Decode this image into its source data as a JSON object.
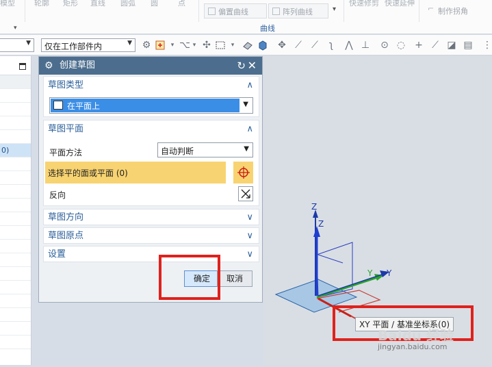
{
  "ribbon": {
    "top_items": [
      "轮廓",
      "矩形",
      "直线",
      "圆弧",
      "圆",
      "点"
    ],
    "offset_curve": "偏置曲线",
    "pattern_curve": "阵列曲线",
    "quick_trim": "快速修剪",
    "quick_extend": "快速延伸",
    "make_corner": "制作拐角",
    "group_label": "曲线",
    "left_item": "模型"
  },
  "toolbar": {
    "filter_value": "",
    "scope_value": "仅在工作部件内"
  },
  "nav": {
    "selected_row": "0)"
  },
  "dialog": {
    "title": "创建草图",
    "sections": {
      "sketch_type": {
        "label": "草图类型",
        "value": "在平面上"
      },
      "sketch_plane": {
        "label": "草图平面",
        "method_label": "平面方法",
        "method_value": "自动判断",
        "select_label": "选择平的面或平面 (0)",
        "reverse_label": "反向"
      },
      "sketch_orientation": {
        "label": "草图方向"
      },
      "sketch_origin": {
        "label": "草图原点"
      },
      "settings": {
        "label": "设置"
      }
    },
    "ok_label": "确定",
    "cancel_label": "取消"
  },
  "viewport": {
    "axis_z": "Z",
    "axis_z2": "Z",
    "axis_y": "Y",
    "axis_y2": "Y",
    "tooltip": "XY 平面 / 基准坐标系(0)"
  },
  "watermark": {
    "logo": "Baidu 经验",
    "url": "jingyan.baidu.com"
  }
}
